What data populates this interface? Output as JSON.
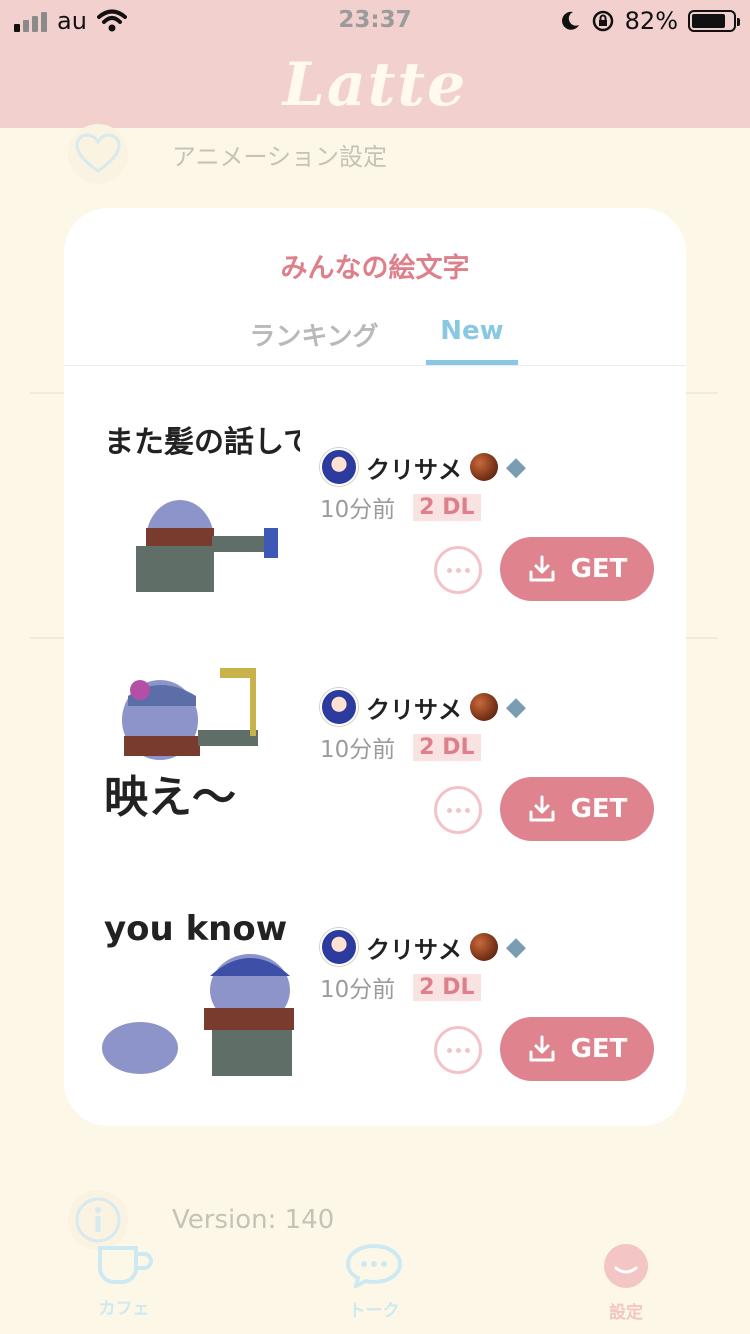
{
  "status": {
    "carrier": "au",
    "time": "23:37",
    "battery": "82%",
    "battery_level": 0.82
  },
  "header": {
    "logo": "Latte"
  },
  "background": {
    "animation_setting": "アニメーション設定",
    "version": "Version: 140"
  },
  "modal": {
    "title": "みんなの絵文字",
    "tabs": [
      {
        "label": "ランキング",
        "active": false
      },
      {
        "label": "New",
        "active": true
      }
    ],
    "items": [
      {
        "user": "クリサメ",
        "time": "10分前",
        "downloads": "2 DL",
        "get_label": "GET",
        "sticker_text": "また髪の話してる。"
      },
      {
        "user": "クリサメ",
        "time": "10分前",
        "downloads": "2 DL",
        "get_label": "GET",
        "sticker_text": "映え〜"
      },
      {
        "user": "クリサメ",
        "time": "10分前",
        "downloads": "2 DL",
        "get_label": "GET",
        "sticker_text": "you know"
      }
    ]
  },
  "nav": {
    "items": [
      {
        "label": "カフェ",
        "icon": "coffee-cup-icon"
      },
      {
        "label": "トーク",
        "icon": "speech-bubble-icon"
      },
      {
        "label": "設定",
        "icon": "settings-face-icon"
      }
    ]
  },
  "colors": {
    "header_bg": "#f1d0cd",
    "page_bg": "#fdf7e7",
    "accent_pink": "#df848f",
    "tab_blue": "#89c8e2"
  }
}
